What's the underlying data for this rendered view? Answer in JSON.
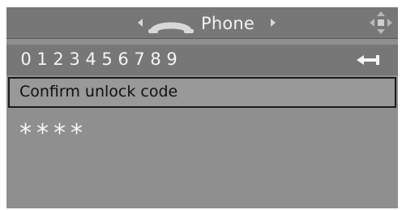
{
  "header": {
    "title": "Phone",
    "left_arrow_icon": "chevron-left-icon",
    "right_arrow_icon": "chevron-right-icon",
    "phone_icon": "phone-handset-icon",
    "nav_icon": "navigation-cross-icon"
  },
  "keypad": {
    "digits": [
      "0",
      "1",
      "2",
      "3",
      "4",
      "5",
      "6",
      "7",
      "8",
      "9"
    ],
    "backspace_icon": "backspace-icon"
  },
  "prompt": {
    "label": "Confirm unlock code"
  },
  "entry": {
    "masked_value": "****"
  },
  "colors": {
    "screen_bg": "#8f8f8f",
    "bar_bg": "#777777",
    "highlight_border": "#1a1a1a",
    "text": "#f2f2f2"
  }
}
